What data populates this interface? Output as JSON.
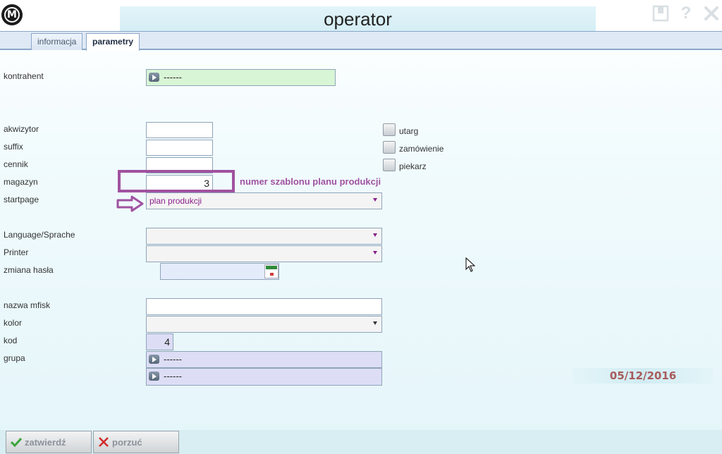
{
  "header": {
    "title": "operator",
    "logo_letter": "M",
    "icons": [
      "book-icon",
      "help-icon",
      "close-icon"
    ]
  },
  "tabs": [
    {
      "label": "informacja",
      "active": false
    },
    {
      "label": "parametry",
      "active": true
    }
  ],
  "form": {
    "kontrahent": {
      "label": "kontrahent",
      "value": "------"
    },
    "akwizytor": {
      "label": "akwizytor",
      "value": ""
    },
    "suffix": {
      "label": "suffix",
      "value": ""
    },
    "cennik": {
      "label": "cennik",
      "value": ""
    },
    "magazyn": {
      "label": "magazyn",
      "value": "3"
    },
    "startpage": {
      "label": "startpage",
      "value": "plan produkcji"
    },
    "language": {
      "label": "Language/Sprache",
      "value": ""
    },
    "printer": {
      "label": "Printer",
      "value": ""
    },
    "zmiana_hasla": {
      "label": "zmiana hasła",
      "value": ""
    },
    "nazwa_mfisk": {
      "label": "nazwa mfisk",
      "value": ""
    },
    "kolor": {
      "label": "kolor",
      "value": ""
    },
    "kod": {
      "label": "kod",
      "value": "4"
    },
    "grupa": {
      "label": "grupa",
      "value": "------",
      "value2": "------"
    }
  },
  "checkboxes": [
    {
      "label": "utarg",
      "checked": false
    },
    {
      "label": "zamówienie",
      "checked": false
    },
    {
      "label": "piekarz",
      "checked": false
    }
  ],
  "annotation": {
    "text": "numer szablonu planu produkcji",
    "color": "#a052a0"
  },
  "date": "05/12/2016",
  "buttons": {
    "confirm": "zatwierdź",
    "cancel": "porzuć"
  }
}
